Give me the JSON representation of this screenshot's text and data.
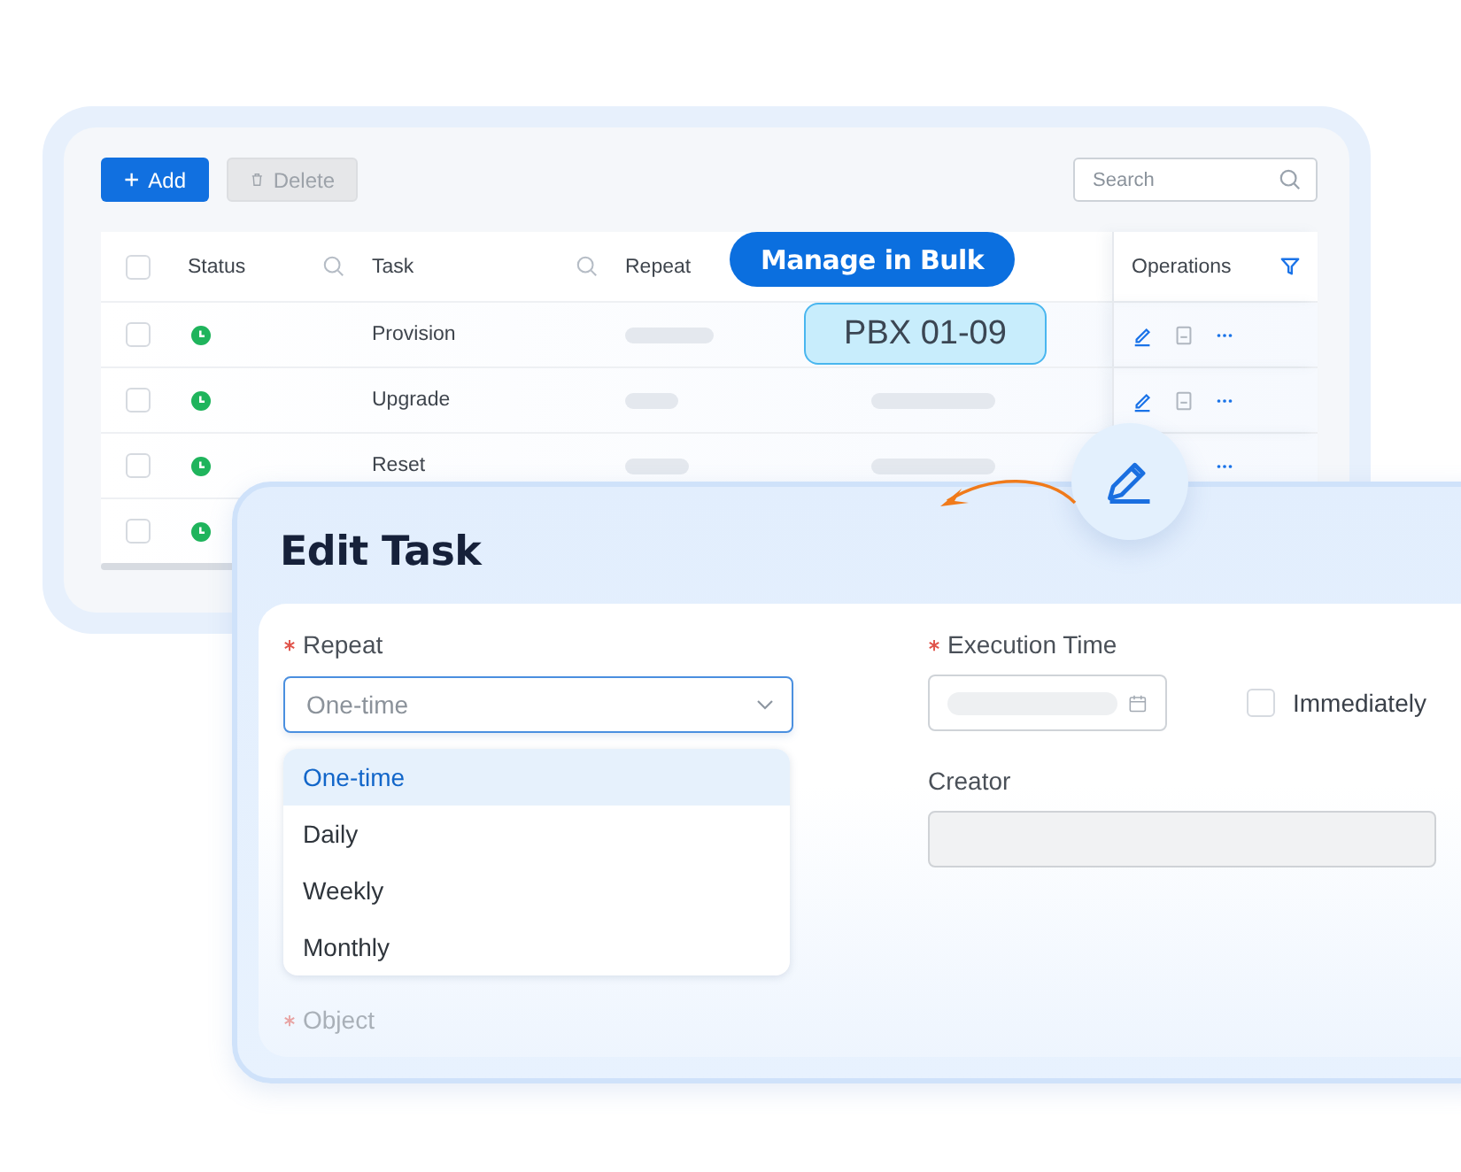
{
  "toolbar": {
    "buttons": [
      {
        "label": "Add",
        "kind": "add",
        "disabled": false
      },
      {
        "label": "Delete",
        "kind": "delete",
        "disabled": true
      }
    ],
    "search": {
      "placeholder": "Search"
    }
  },
  "table": {
    "header_checked": false,
    "columns": [
      {
        "label": "Status",
        "kind": "search"
      },
      {
        "label": "Task",
        "kind": "search"
      },
      {
        "label": "Repeat",
        "kind": "plain"
      },
      {
        "label": "Operations",
        "kind": "filter"
      }
    ],
    "rows": [
      {
        "checked": false,
        "color": "#1fb45c",
        "task": "Provision"
      },
      {
        "checked": false,
        "color": "#1fb45c",
        "task": "Upgrade"
      },
      {
        "checked": false,
        "color": "#1fb45c",
        "task": "Reset"
      },
      {
        "checked": false,
        "color": "#1fb45c"
      }
    ]
  },
  "bulk_tooltip": {
    "label": "Manage in Bulk",
    "target": "PBX 01-09"
  },
  "edit_dialog": {
    "title": "Edit Task",
    "repeat": {
      "label": "Repeat",
      "required": true,
      "placeholder": "One-time",
      "options": [
        {
          "label": "One-time",
          "selected": true
        },
        {
          "label": "Daily",
          "selected": false
        },
        {
          "label": "Weekly",
          "selected": false
        },
        {
          "label": "Monthly",
          "selected": false
        }
      ]
    },
    "object": {
      "label": "Object",
      "required": true,
      "disabled": true
    },
    "execution_time": {
      "label": "Execution Time",
      "required": true,
      "immediately": {
        "label": "Immediately",
        "checked": false
      }
    },
    "creator": {
      "label": "Creator",
      "required": false,
      "disabled": true
    }
  }
}
